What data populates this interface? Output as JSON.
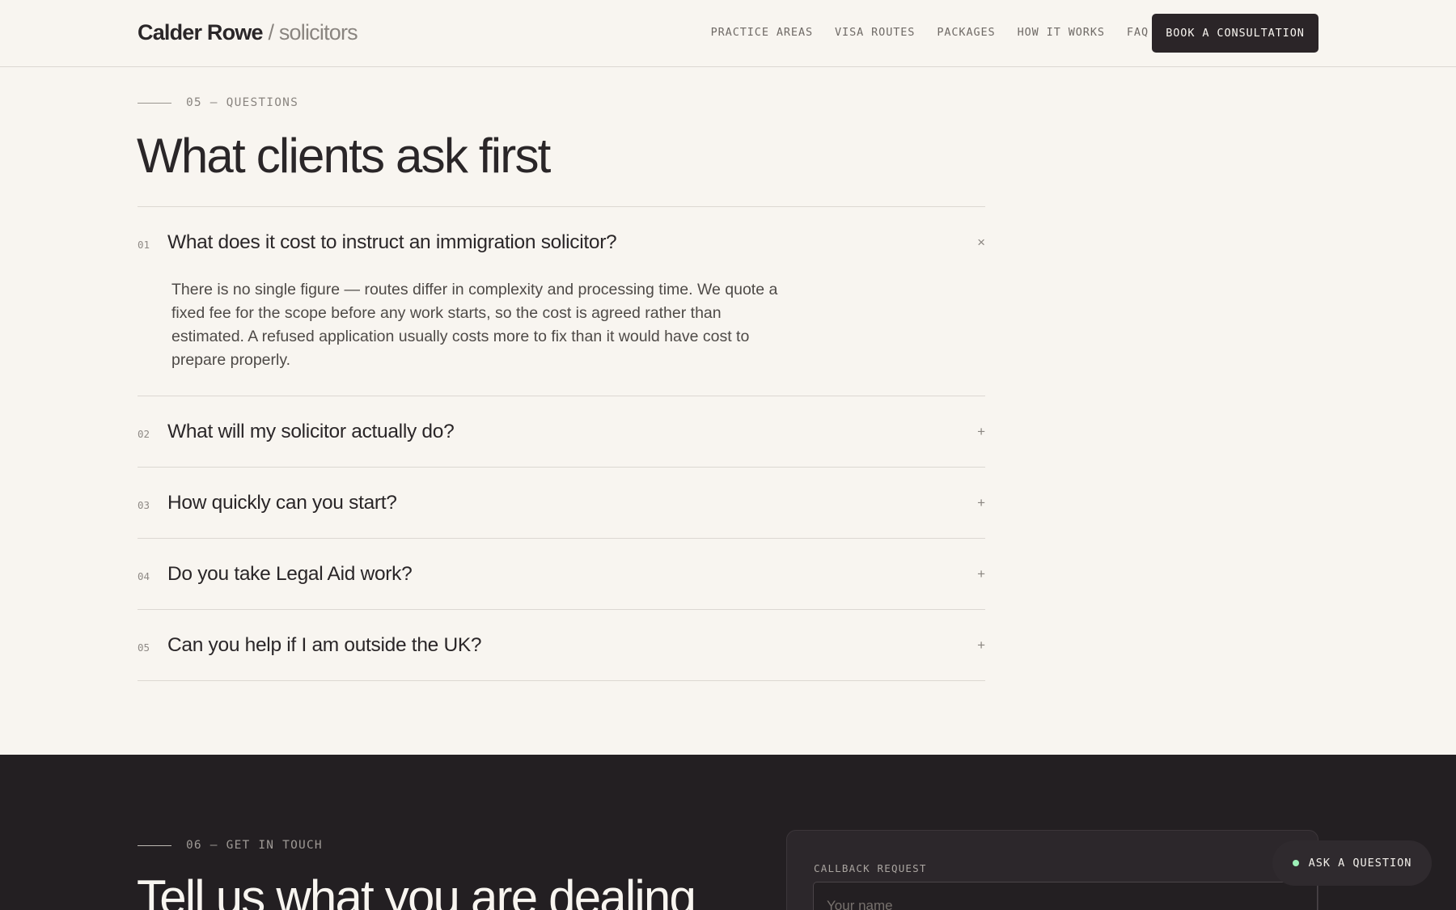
{
  "header": {
    "logo_name": "Calder Rowe",
    "logo_slash": "/",
    "logo_suffix": "solicitors",
    "nav": [
      "PRACTICE AREAS",
      "VISA ROUTES",
      "PACKAGES",
      "HOW IT WORKS",
      "FAQ"
    ],
    "cta": "BOOK A CONSULTATION"
  },
  "faq_section": {
    "eyebrow": "05 — QUESTIONS",
    "title": "What clients ask first",
    "items": [
      {
        "num": "01",
        "question": "What does it cost to instruct an immigration solicitor?",
        "open": true,
        "toggle": "×",
        "answer": "There is no single figure — routes differ in complexity and processing time. We quote a fixed fee for the scope before any work starts, so the cost is agreed rather than estimated. A refused application usually costs more to fix than it would have cost to prepare properly."
      },
      {
        "num": "02",
        "question": "What will my solicitor actually do?",
        "open": false,
        "toggle": "+"
      },
      {
        "num": "03",
        "question": "How quickly can you start?",
        "open": false,
        "toggle": "+"
      },
      {
        "num": "04",
        "question": "Do you take Legal Aid work?",
        "open": false,
        "toggle": "+"
      },
      {
        "num": "05",
        "question": "Can you help if I am outside the UK?",
        "open": false,
        "toggle": "+"
      }
    ]
  },
  "contact_section": {
    "eyebrow": "06 — GET IN TOUCH",
    "title": "Tell us what you are dealing",
    "form": {
      "label": "CALLBACK REQUEST",
      "name_placeholder": "Your name"
    }
  },
  "floating": {
    "ask_label": "ASK A QUESTION",
    "status_color": "#9df0b8"
  }
}
